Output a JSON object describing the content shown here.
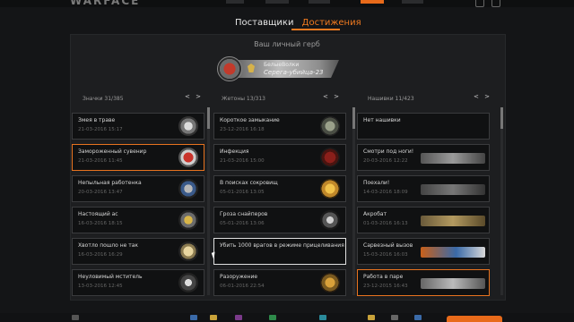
{
  "app": {
    "logo_text": "WARFACE"
  },
  "tabs": {
    "suppliers": "Поставщики",
    "achievements": "Достижения"
  },
  "crest": {
    "title": "Ваш личный герб",
    "clan": "БелыеВолки",
    "player": "Серега-убийца-23"
  },
  "columns": [
    {
      "header": "Значки 31/385",
      "arrows": "< >"
    },
    {
      "header": "Жетоны 13/313",
      "arrows": "< >"
    },
    {
      "header": "Нашивки 11/423",
      "arrows": "< >"
    }
  ],
  "badges": [
    {
      "name": "Змея в траве",
      "date": "21-03-2016 15:17"
    },
    {
      "name": "Замороженный сувенир",
      "date": "21-03-2016 11:45"
    },
    {
      "name": "Непыльная работенка",
      "date": "20-03-2016 13:47"
    },
    {
      "name": "Настоящий ас",
      "date": "16-03-2016 18:15"
    },
    {
      "name": "Хвотло пошло не так",
      "date": "16-03-2016 16:29"
    },
    {
      "name": "Неуловимый мститель",
      "date": "13-03-2016 12:45"
    }
  ],
  "tokens": [
    {
      "name": "Короткое замыкание",
      "date": "23-12-2016 16:18"
    },
    {
      "name": "Инфекция",
      "date": "21-03-2016 15:00"
    },
    {
      "name": "В поисках сокровищ",
      "date": "05-01-2016 13:05"
    },
    {
      "name": "Гроза снайперов",
      "date": "05-01-2016 13:06"
    },
    {
      "name": "Убить 1000 врагов в режиме прицеливания",
      "date": ""
    },
    {
      "name": "Разоружение",
      "date": "06-01-2016 22:54"
    }
  ],
  "stripes": [
    {
      "name": "Нет нашивки",
      "date": ""
    },
    {
      "name": "Смотри под ноги!",
      "date": "20-03-2016 12:22"
    },
    {
      "name": "Поехали!",
      "date": "14-03-2016 18:09"
    },
    {
      "name": "Акробат",
      "date": "01-03-2016 16:13"
    },
    {
      "name": "Сарвезный вызов",
      "date": "15-03-2016 16:03"
    },
    {
      "name": "Работа в паре",
      "date": "23-12-2015 16:43"
    }
  ],
  "colors": {
    "accent": "#e86a1a",
    "bg": "#141517"
  }
}
